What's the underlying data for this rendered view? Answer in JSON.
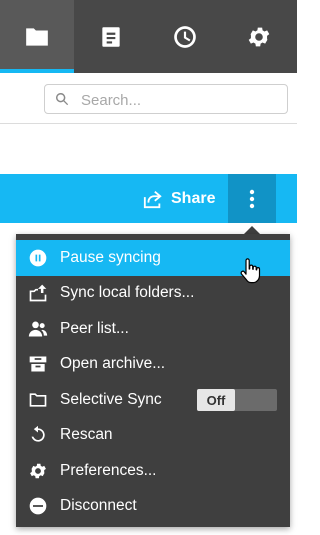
{
  "tabs": [
    {
      "icon": "folder-icon",
      "active": true
    },
    {
      "icon": "document-icon",
      "active": false
    },
    {
      "icon": "clock-icon",
      "active": false
    },
    {
      "icon": "gear-icon",
      "active": false
    }
  ],
  "search": {
    "placeholder": "Search..."
  },
  "toolbar": {
    "share_label": "Share"
  },
  "menu": {
    "items": [
      {
        "label": "Pause syncing",
        "icon": "pause-icon",
        "highlighted": true
      },
      {
        "label": "Sync local folders...",
        "icon": "upload-folder-icon"
      },
      {
        "label": "Peer list...",
        "icon": "users-icon"
      },
      {
        "label": "Open archive...",
        "icon": "archive-icon"
      },
      {
        "label": "Selective Sync",
        "icon": "folder-outline-icon",
        "toggle": "Off"
      },
      {
        "label": "Rescan",
        "icon": "rescan-icon"
      },
      {
        "label": "Preferences...",
        "icon": "gear-icon"
      },
      {
        "label": "Disconnect",
        "icon": "disconnect-icon"
      }
    ]
  },
  "colors": {
    "accent": "#16b8f3",
    "accent_dark": "#1193c6",
    "tabbar": "#484848",
    "menu_bg": "#3f3f3f"
  }
}
